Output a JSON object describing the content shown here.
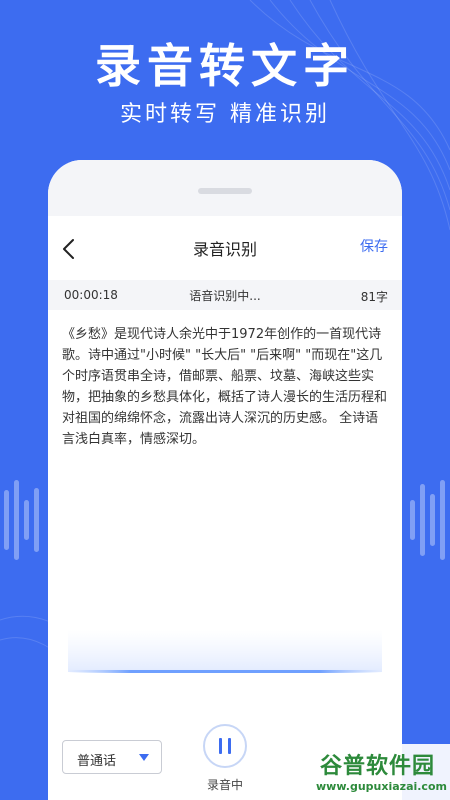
{
  "hero": {
    "title": "录音转文字",
    "subtitle": "实时转写 精准识别"
  },
  "navbar": {
    "title": "录音识别",
    "save_label": "保存"
  },
  "status": {
    "elapsed": "00:00:18",
    "state": "语音识别中...",
    "char_count": "81字"
  },
  "transcript": {
    "text": "《乡愁》是现代诗人余光中于1972年创作的一首现代诗歌。诗中通过\"小时候\" \"长大后\" \"后来啊\" \"而现在\"这几个时序语贯串全诗，借邮票、船票、坟墓、海峡这些实物，把抽象的乡愁具体化，概括了诗人漫长的生活历程和对祖国的绵绵怀念，流露出诗人深沉的历史感。 全诗语言浅白真率，情感深切。"
  },
  "controls": {
    "language": "普通话",
    "record_label": "录音中"
  },
  "watermark": {
    "title": "谷普软件园",
    "url": "www.gupuxiazai.com"
  },
  "colors": {
    "background": "#3d6cf0",
    "accent": "#3d6cf0"
  }
}
